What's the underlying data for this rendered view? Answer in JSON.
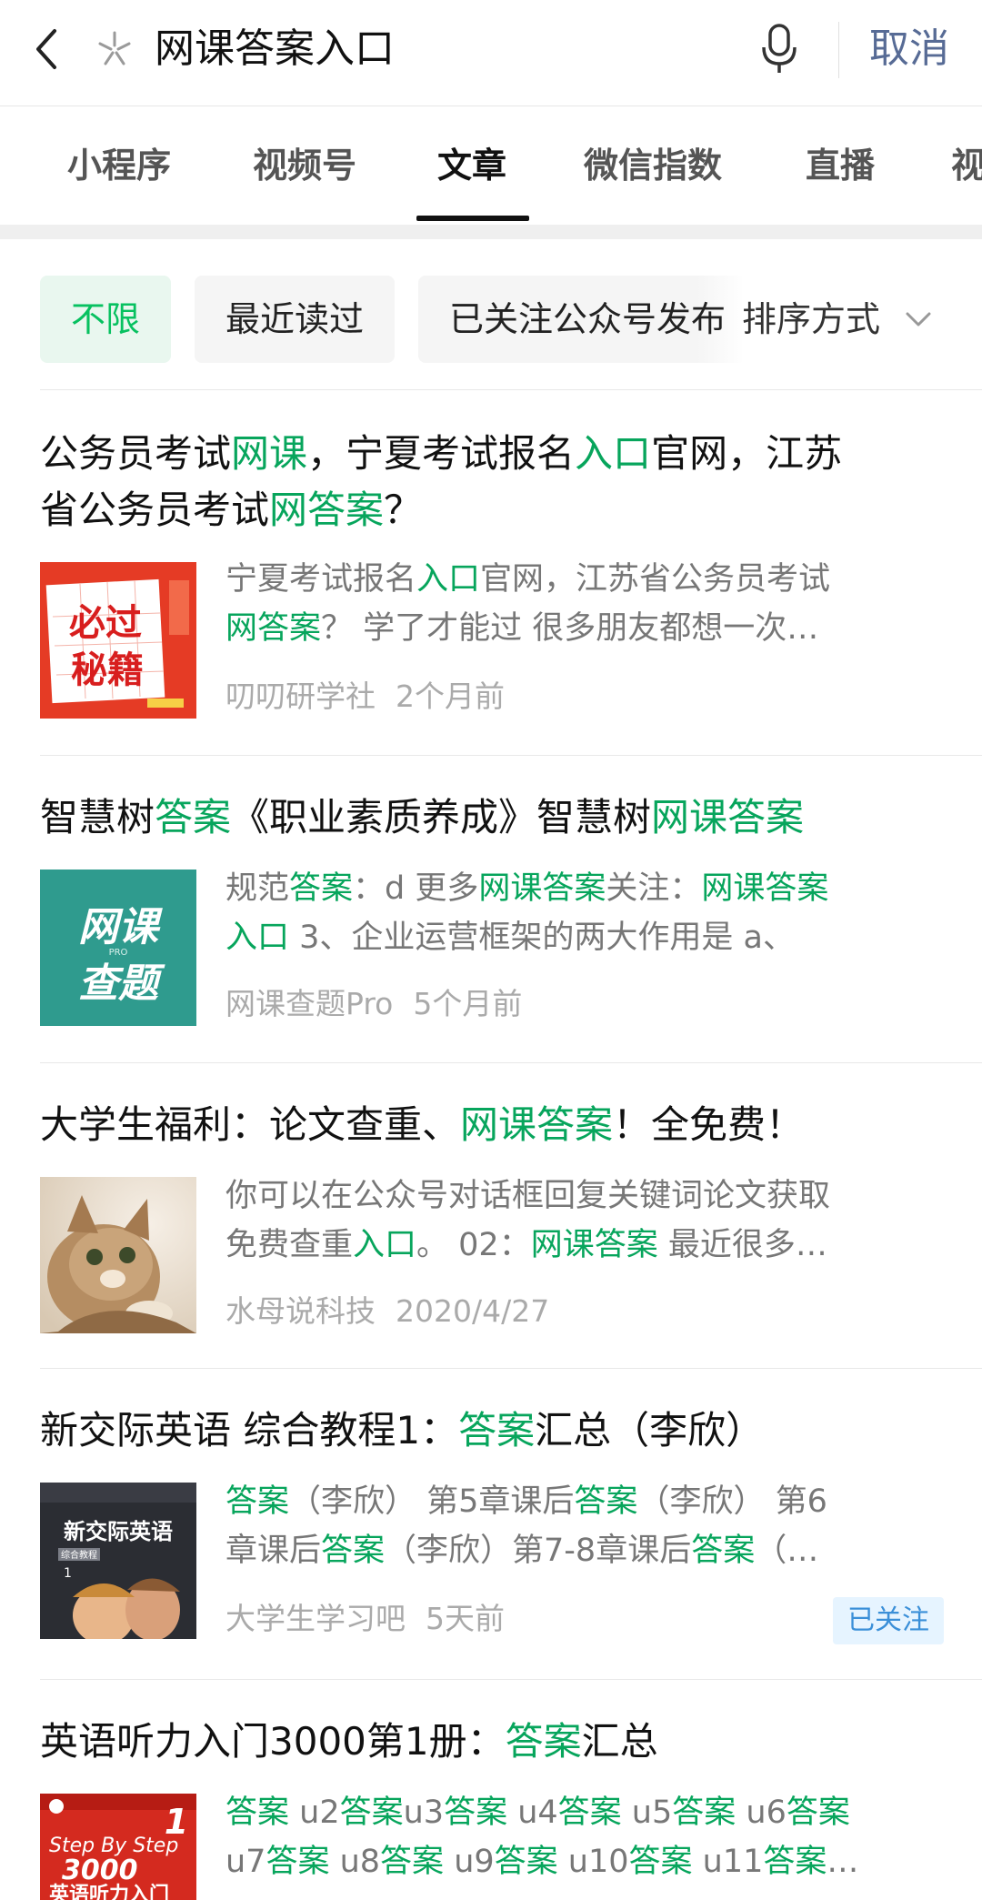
{
  "search": {
    "query": "网课答案入口",
    "cancel_label": "取消"
  },
  "tabs": [
    {
      "label": "小程序"
    },
    {
      "label": "视频号"
    },
    {
      "label": "文章"
    },
    {
      "label": "微信指数"
    },
    {
      "label": "直播"
    },
    {
      "label": "视"
    }
  ],
  "active_tab": "文章",
  "filters": {
    "chips": [
      {
        "label": "不限"
      },
      {
        "label": "最近读过"
      },
      {
        "label": "已关注公众号发布"
      }
    ],
    "sort_label": "排序方式"
  },
  "results": [
    {
      "title_parts": [
        "公务员考试",
        "网课",
        "，宁夏考试报名",
        "入口",
        "官网，江苏",
        "省公务员考试",
        "网答案",
        "？"
      ],
      "snippet": {
        "line1": [
          "宁夏考试报名",
          "入口",
          "官网，江苏省公务员考试"
        ],
        "line2": [
          "网答案",
          "？ 学了才能过 很多朋友都想一次…"
        ]
      },
      "source": "叨叨研学社",
      "date": "2个月前",
      "thumb_text": [
        "必过",
        "秘籍"
      ]
    },
    {
      "title_parts": [
        "智慧树",
        "答案",
        "《职业素质养成》智慧树",
        "网课答案"
      ],
      "snippet": {
        "line1": [
          "规范",
          "答案",
          "：d 更多",
          "网课答案",
          "关注：",
          "网课答案"
        ],
        "line2": [
          "入口",
          " 3、企业运营框架的两大作用是 a、"
        ]
      },
      "source": "网课查题Pro",
      "date": "5个月前",
      "thumb_text": [
        "网课",
        "查题",
        "PRO"
      ]
    },
    {
      "title_parts": [
        "大学生福利：论文查重、",
        "网课答案",
        "！全免费！"
      ],
      "snippet": {
        "line1": [
          "你可以在公众号对话框回复关键词论文获取"
        ],
        "line2": [
          "免费查重",
          "入口",
          "。 02：",
          "网课答案",
          " 最近很多…"
        ]
      },
      "source": "水母说科技",
      "date": "2020/4/27"
    },
    {
      "title_parts": [
        "新交际英语 综合教程1：",
        "答案",
        "汇总（李欣）"
      ],
      "snippet": {
        "line1": [
          "答案",
          "（李欣） 第5章课后",
          "答案",
          "（李欣） 第6"
        ],
        "line2": [
          "章课后",
          "答案",
          "（李欣）第7-8章课后",
          "答案",
          "（…"
        ]
      },
      "source": "大学生学习吧",
      "date": "5天前",
      "badge": "已关注",
      "thumb_text": [
        "新交际英语",
        "综合教程",
        "1"
      ]
    },
    {
      "title_parts": [
        "英语听力入门3000第1册：",
        "答案",
        "汇总"
      ],
      "snippet": {
        "line1": [
          "答案",
          " u2",
          "答案",
          "u3",
          "答案",
          " u4",
          "答案",
          " u5",
          "答案",
          " u6",
          "答案"
        ],
        "line2": [
          "u7",
          "答案",
          " u8",
          "答案",
          " u9",
          "答案",
          " u10",
          "答案",
          " u11",
          "答案",
          "…"
        ]
      },
      "thumb_text": [
        "1",
        "Step By Step",
        "3000",
        "英语听力入门"
      ]
    }
  ],
  "colors": {
    "highlight": "#07a55c",
    "cancel": "#576b95",
    "chip_on": "#07c160",
    "badge_text": "#3a8fd8"
  }
}
